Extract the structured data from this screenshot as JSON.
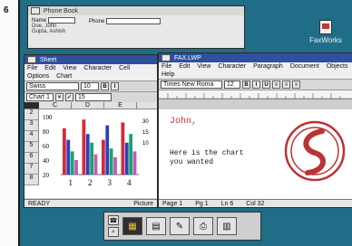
{
  "figure_number": "6",
  "phone_book": {
    "title": "Phone Book",
    "col_name": "Name",
    "col_phone": "Phone",
    "entries": [
      "Doe, John",
      "Gupta, Ashish"
    ]
  },
  "desktop": {
    "faxworks_label": "FaxWorks"
  },
  "sheet": {
    "title": "Sheet",
    "menu": [
      "File",
      "Edit",
      "View",
      "Character",
      "Cell",
      "Options",
      "Chart"
    ],
    "font_name": "Swiss",
    "font_size": "10",
    "chart_label": "Chart 1",
    "cell_value": "15",
    "col_headers": [
      "C",
      "D",
      "E"
    ],
    "row_headers": [
      "2",
      "3",
      "4",
      "5",
      "6",
      "7",
      "8"
    ],
    "status_left": "READY",
    "status_right": "Picture"
  },
  "fax": {
    "title": "FAX.LWP",
    "menu": [
      "File",
      "Edit",
      "View",
      "Character",
      "Paragraph",
      "Document",
      "Objects",
      "Help"
    ],
    "font_name": "Times New Roma",
    "font_size": "12",
    "greeting": "John,",
    "body": "Here is the chart you wanted",
    "status": [
      "Page 1",
      "Pg 1",
      "Ln 6",
      "Col 32"
    ]
  },
  "chart_data": {
    "type": "bar",
    "categories": [
      "1",
      "2",
      "3",
      "4"
    ],
    "series": [
      {
        "values": [
          80,
          95,
          60,
          90
        ]
      },
      {
        "values": [
          60,
          70,
          85,
          55
        ]
      },
      {
        "values": [
          40,
          55,
          45,
          70
        ]
      },
      {
        "values": [
          25,
          35,
          30,
          40
        ]
      }
    ],
    "y_ticks_left": [
      "100",
      "80",
      "60",
      "40",
      "20"
    ],
    "y_ticks_right": [
      "30",
      "15",
      "10"
    ],
    "ylim": [
      0,
      100
    ],
    "colors": [
      "#d8283a",
      "#2a3fbf",
      "#18a36a",
      "#c25bbd"
    ]
  },
  "taskbar": {
    "icons": [
      "phone-book-icon",
      "search-icon",
      "spreadsheet-icon",
      "notes-icon",
      "pen-icon",
      "printer-icon",
      "chart-icon"
    ]
  }
}
